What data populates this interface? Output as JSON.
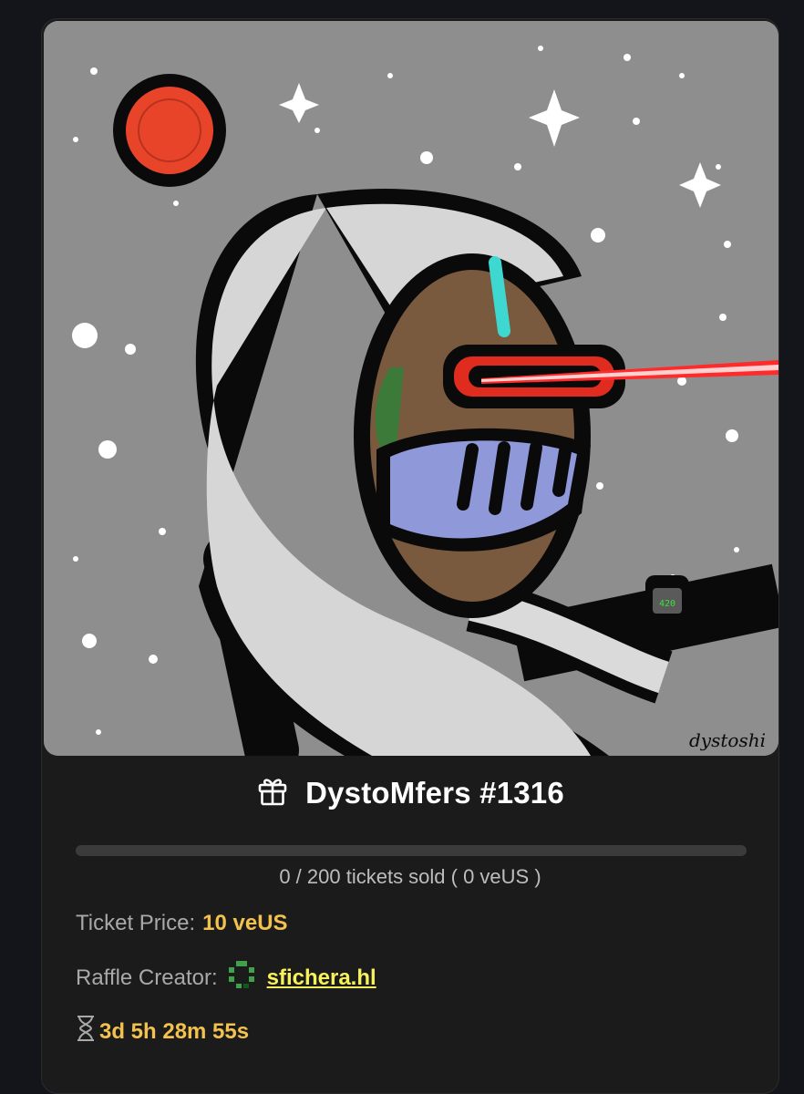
{
  "raffle": {
    "title": "DystoMfers #1316",
    "tickets_sold": 0,
    "tickets_total": 200,
    "sold_text": "0 / 200 tickets sold ( 0 veUS )",
    "ticket_price_label": "Ticket Price:",
    "ticket_price_value": "10 veUS",
    "creator_label": "Raffle Creator:",
    "creator_name": "sfichera.hl",
    "countdown": "3d 5h 28m 55s"
  },
  "artwork": {
    "signature": "dystoshi",
    "watch_text": "420"
  },
  "icons": {
    "title_icon": "gift-icon",
    "countdown_icon": "hourglass-icon",
    "creator_avatar": "pixel-avatar-icon"
  },
  "colors": {
    "accent": "#f2c14e",
    "link": "#f7f25a",
    "card_bg": "#1b1b1b",
    "page_bg": "#14151a"
  }
}
